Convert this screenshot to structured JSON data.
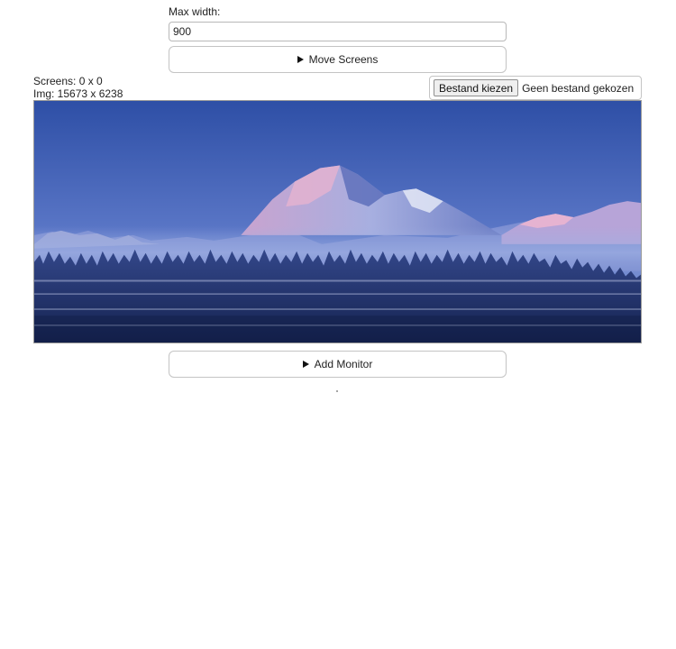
{
  "max_width": {
    "label": "Max width:",
    "value": "900"
  },
  "move_screens": {
    "label": "Move Screens"
  },
  "info": {
    "screens": "Screens: 0 x 0",
    "img": "Img: 15673 x 6238"
  },
  "file_input": {
    "button_label": "Bestand kiezen",
    "status": "Geen bestand gekozen"
  },
  "add_monitor": {
    "label": "Add Monitor"
  },
  "colors": {
    "sky_top": "#2f52a8",
    "sky_bottom": "#8aa0dc",
    "forest": "#1c2d63",
    "snow": "#dfe6f7",
    "alpenglow": "#e7a6c6"
  },
  "icons": {
    "disclosure": "triangle-right-icon"
  }
}
